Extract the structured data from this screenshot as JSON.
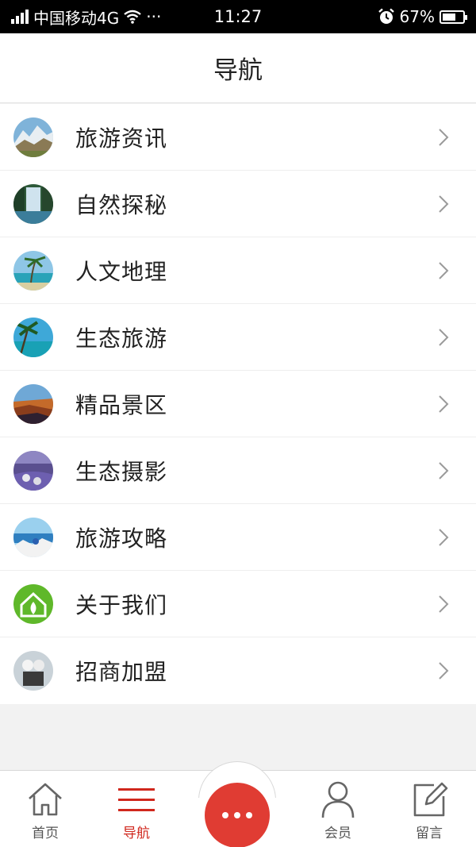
{
  "status_bar": {
    "carrier": "中国移动4G",
    "dots": "···",
    "time": "11:27",
    "battery_percent": "67%",
    "battery_level": 0.67
  },
  "header": {
    "title": "导航"
  },
  "nav_items": [
    {
      "label": "旅游资讯",
      "icon": "mountain-photo-icon"
    },
    {
      "label": "自然探秘",
      "icon": "waterfall-photo-icon"
    },
    {
      "label": "人文地理",
      "icon": "palm-beach-photo-icon"
    },
    {
      "label": "生态旅游",
      "icon": "tropical-beach-photo-icon"
    },
    {
      "label": "精品景区",
      "icon": "canyon-photo-icon"
    },
    {
      "label": "生态摄影",
      "icon": "lavender-photo-icon"
    },
    {
      "label": "旅游攻略",
      "icon": "seaside-town-photo-icon"
    },
    {
      "label": "关于我们",
      "icon": "green-house-icon"
    },
    {
      "label": "招商加盟",
      "icon": "figures-photo-icon"
    }
  ],
  "tab_bar": {
    "home": "首页",
    "nav": "导航",
    "member": "会员",
    "message": "留言",
    "active_color": "#d0271d",
    "center_button_color": "#e03c33"
  }
}
